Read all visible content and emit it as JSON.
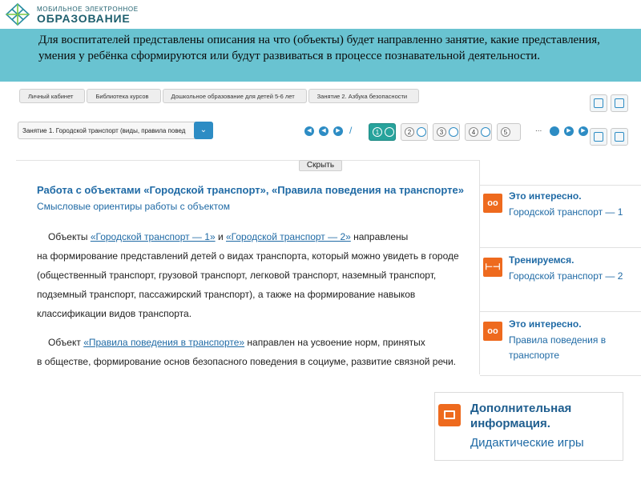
{
  "logo": {
    "small": "МОБИЛЬНОЕ ЭЛЕКТРОННОЕ",
    "big": "ОБРАЗОВАНИЕ"
  },
  "banner": {
    "text": "Для воспитателей представлены описания на что (объекты) будет направленно занятие, какие представления, умения у ребёнка сформируются или будут развиваться в процессе познавательной деятельности."
  },
  "breadcrumbs": [
    "Личный кабинет",
    "Библиотека курсов",
    "Дошкольное образование для детей 5-6 лет",
    "Занятие 2. Азбука безопасности"
  ],
  "lesson_select": {
    "value": "Занятие 1. Городской транспорт (виды, правила повед"
  },
  "pager": {
    "pages": [
      "1",
      "2",
      "3",
      "4",
      "5"
    ],
    "ellipsis": "...",
    "active": 1
  },
  "hide_button": "Скрыть",
  "content": {
    "title": "Работа с объектами «Городской транспорт», «Правила поведения на транспорте»",
    "subtitle": "Смысловые ориентиры работы с объектом",
    "p1": {
      "pre": "Объекты ",
      "link1": "«Городской транспорт — 1»",
      "mid": " и ",
      "link2": "«Городской транспорт — 2»",
      "post": " направлены",
      "line2": "на формирование представлений детей о видах транспорта, который можно увидеть в городе",
      "line3": "(общественный транспорт, грузовой транспорт, легковой транспорт, наземный транспорт,",
      "line4": "подземный транспорт, пассажирский транспорт), а также на формирование навыков",
      "line5": "классификации видов транспорта."
    },
    "p2": {
      "pre": "Объект ",
      "link": "«Правила поведения в транспорте»",
      "post": " направлен на усвоение норм, принятых",
      "line2": "в обществе, формирование основ безопасного поведения в социуме, развитие связной речи."
    }
  },
  "side_cards": [
    {
      "icon": "binoculars-icon",
      "title": "Это интересно.",
      "text": "Городской транспорт — 1"
    },
    {
      "icon": "dumbbell-icon",
      "title": "Тренируемся.",
      "text": "Городской транспорт — 2"
    },
    {
      "icon": "binoculars-icon",
      "title": "Это интересно.",
      "text": "Правила поведения в транспорте"
    }
  ],
  "extra_card": {
    "title": "Дополнительная информация.",
    "text": "Дидактические игры"
  },
  "colors": {
    "banner": "#69c3d1",
    "link": "#1f6aa5",
    "accent_orange": "#ee6a1e",
    "active_page": "#27a39c"
  }
}
